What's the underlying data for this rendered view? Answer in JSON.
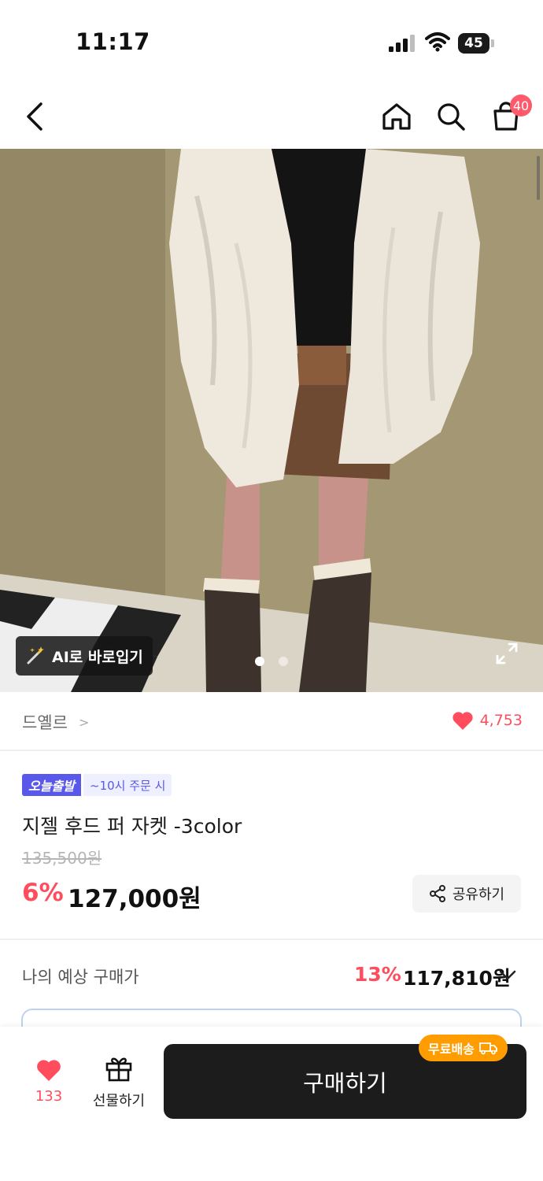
{
  "status_bar": {
    "time": "11:17",
    "battery": "45"
  },
  "nav": {
    "back_icon": "chevron-left-icon",
    "home_icon": "home-icon",
    "search_icon": "search-icon",
    "cart_icon": "shopping-bag-icon",
    "cart_badge": "40"
  },
  "hero": {
    "ai_button_label": "AI로 바로입기",
    "slide_count": 2,
    "active_slide": 1
  },
  "brand": {
    "name": "드옐르",
    "chevron": ">",
    "likes": "4,753"
  },
  "product": {
    "tag_today": "오늘출발",
    "tag_order": "~10시 주문 시",
    "title": "지젤 후드 퍼 자켓 -3color",
    "original_price": "135,500원",
    "discount": "6%",
    "price": "127,000원",
    "share_label": "공유하기"
  },
  "estimate": {
    "label": "나의 예상 구매가",
    "discount": "13%",
    "price": "117,810원"
  },
  "bottom_bar": {
    "wish_count": "133",
    "gift_label": "선물하기",
    "buy_label": "구매하기",
    "free_shipping_label": "무료배송"
  },
  "colors": {
    "accent_red": "#ff4d5e",
    "today_tag": "#5a58ea",
    "buy_button": "#1c1c1c",
    "free_ship_badge": "#ff9d00"
  }
}
